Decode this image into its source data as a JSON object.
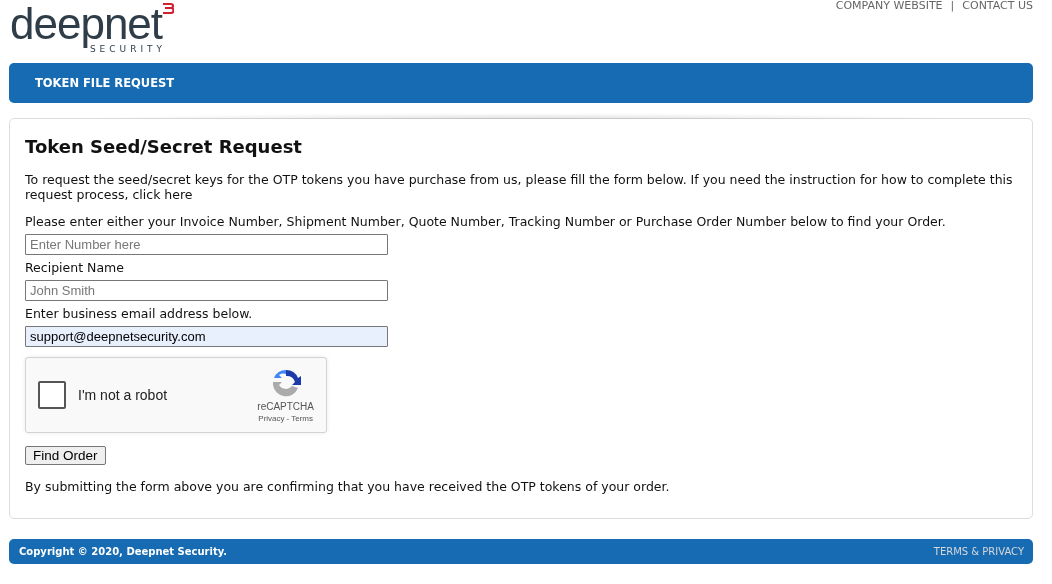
{
  "logo": {
    "name": "deepnet",
    "tagline": "SECURITY"
  },
  "top_links": [
    {
      "label": "COMPANY WEBSITE"
    },
    {
      "label": "CONTACT US"
    }
  ],
  "top_links_separator": "|",
  "title_bar": {
    "title": "TOKEN FILE REQUEST"
  },
  "form": {
    "heading": "Token Seed/Secret Request",
    "intro": "To request the seed/secret keys for the OTP tokens you have purchase from us, please fill the form below. If you need the instruction for how to complete this request process, click here",
    "fields": [
      {
        "label": "Please enter either your Invoice Number, Shipment Number, Quote Number, Tracking Number or Purchase Order Number below to find your Order.",
        "placeholder": "Enter Number here",
        "autofilled": false
      },
      {
        "label": "Recipient Name",
        "placeholder": "John Smith",
        "autofilled": false
      },
      {
        "label": "Enter business email address below.",
        "value": "support@deepnetsecurity.com",
        "autofilled": true
      }
    ],
    "captcha": {
      "label": "I'm not a robot",
      "checked": false,
      "brand": "reCAPTCHA",
      "privacy": "Privacy",
      "dash": "-",
      "terms": "Terms"
    },
    "button": "Find Order",
    "note": "By submitting the form above you are confirming that you have received the OTP tokens of your order."
  },
  "footer": {
    "copyright": "Copyright © 2020, Deepnet Security.",
    "link": "TERMS & PRIVACY"
  }
}
